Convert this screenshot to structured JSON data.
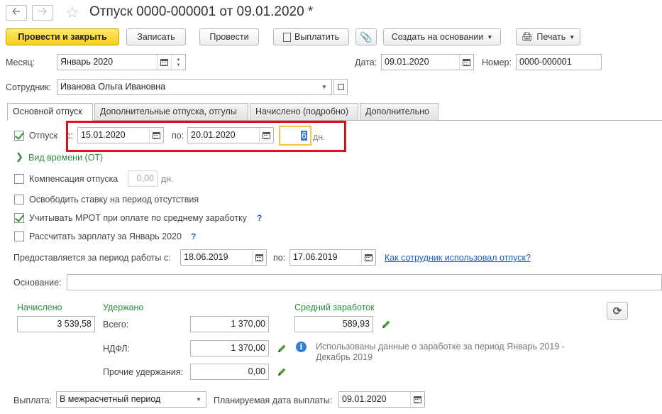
{
  "window": {
    "title": "Отпуск 0000-000001 от 09.01.2020 *"
  },
  "toolbar": {
    "post_close": "Провести и закрыть",
    "save": "Записать",
    "post": "Провести",
    "pay": "Выплатить",
    "create_based": "Создать на основании",
    "print": "Печать"
  },
  "header": {
    "month_label": "Месяц:",
    "month_value": "Январь 2020",
    "date_label": "Дата:",
    "date_value": "09.01.2020",
    "number_label": "Номер:",
    "number_value": "0000-000001",
    "employee_label": "Сотрудник:",
    "employee_value": "Иванова Ольга Ивановна"
  },
  "tabs": [
    {
      "label": "Основной отпуск"
    },
    {
      "label": "Дополнительные отпуска, отгулы"
    },
    {
      "label": "Начислено (подробно)"
    },
    {
      "label": "Дополнительно"
    }
  ],
  "main": {
    "vacation_label": "Отпуск",
    "from_label": "с:",
    "from_value": "15.01.2020",
    "to_label": "по:",
    "to_value": "20.01.2020",
    "days_value": "6",
    "days_unit": "дн.",
    "time_type": "Вид времени (ОТ)",
    "compensation_label": "Компенсация отпуска",
    "compensation_value": "0,00",
    "compensation_unit": "дн.",
    "release_rate": "Освободить ставку на период отсутствия",
    "mrot_label": "Учитывать МРОТ при оплате по среднему заработку",
    "calc_salary_label": "Рассчитать зарплату за Январь 2020",
    "help": "?",
    "period_label": "Предоставляется за период работы с:",
    "period_from": "18.06.2019",
    "period_to_label": "по:",
    "period_to": "17.06.2019",
    "usage_link": "Как сотрудник использовал отпуск?",
    "basis_label": "Основание:",
    "basis_value": ""
  },
  "totals": {
    "accrued_label": "Начислено",
    "accrued_value": "3 539,58",
    "withheld_label": "Удержано",
    "total_label": "Всего:",
    "total_value": "1 370,00",
    "ndfl_label": "НДФЛ:",
    "ndfl_value": "1 370,00",
    "other_label": "Прочие удержания:",
    "other_value": "0,00",
    "avg_label": "Средний заработок",
    "avg_value": "589,93",
    "info_text_1": "Использованы данные о заработке за период Январь 2019 -",
    "info_text_2": "Декабрь 2019"
  },
  "footer": {
    "payment_label": "Выплата:",
    "payment_value": "В межрасчетный период",
    "planned_date_label": "Планируемая дата выплаты:",
    "planned_date_value": "09.01.2020"
  },
  "colors": {
    "accent_yellow": "#f5cf1c",
    "highlight_red": "#d6121a",
    "green_label": "#2e8b3e",
    "link_blue": "#1f5bbf"
  }
}
